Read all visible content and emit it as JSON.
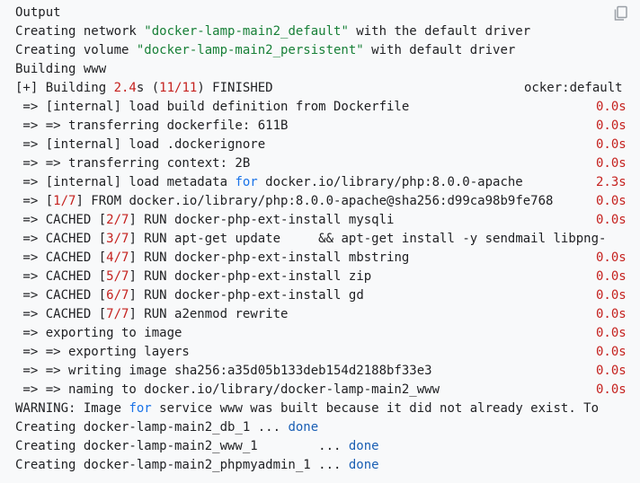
{
  "output_label": "Output",
  "copy_icon": "copy-icon",
  "lines": {
    "l1a": "Creating network ",
    "l1b": "\"docker-lamp-main2_default\"",
    "l1c": " with the default driver",
    "l2a": "Creating volume ",
    "l2b": "\"docker-lamp-main2_persistent\"",
    "l2c": " with default driver",
    "l3": "Building www",
    "l4a": "[+] Building ",
    "l4b": "2.4",
    "l4c": "s (",
    "l4d": "11/11",
    "l4e": ") FINISHED",
    "l4f": "ocker:default",
    "l5": " => [internal] load build definition from Dockerfile",
    "l5t": "0.0s",
    "l6": " => => transferring dockerfile: 611B",
    "l6t": "0.0s",
    "l7": " => [internal] load .dockerignore",
    "l7t": "0.0s",
    "l8": " => => transferring context: 2B",
    "l8t": "0.0s",
    "l9a": " => [internal] load metadata ",
    "l9b": "for",
    "l9c": " docker.io/library/php:8.0.0-apache",
    "l9t": "2.3s",
    "l10a": " => [",
    "l10b": "1/7",
    "l10c": "] FROM docker.io/library/php:8.0.0-apache@sha256:d99ca98b9fe768 ",
    "l10t": "0.0s",
    "l11a": " => CACHED [",
    "l11b": "2/7",
    "l11c": "] RUN docker-php-ext-install mysqli",
    "l11t": "0.0s",
    "l12a": " => CACHED [",
    "l12b": "3/7",
    "l12c": "] RUN apt-get update     && apt-get install -y sendmail libpng-",
    "l13a": " => CACHED [",
    "l13b": "4/7",
    "l13c": "] RUN docker-php-ext-install mbstring",
    "l13t": "0.0s",
    "l14a": " => CACHED [",
    "l14b": "5/7",
    "l14c": "] RUN docker-php-ext-install zip",
    "l14t": "0.0s",
    "l15a": " => CACHED [",
    "l15b": "6/7",
    "l15c": "] RUN docker-php-ext-install gd",
    "l15t": "0.0s",
    "l16a": " => CACHED [",
    "l16b": "7/7",
    "l16c": "] RUN a2enmod rewrite",
    "l16t": "0.0s",
    "l17": " => exporting to image",
    "l17t": "0.0s",
    "l18": " => => exporting layers",
    "l18t": "0.0s",
    "l19": " => => writing image sha256:a35d05b133deb154d2188bf33e3",
    "l19t": "0.0s",
    "l20": " => => naming to docker.io/library/docker-lamp-main2_www",
    "l20t": "0.0s",
    "l21a": "WARNING: Image ",
    "l21b": "for",
    "l21c": " service www was built because it did not already exist. To",
    "l22a": "Creating docker-lamp-main2_db_1 ... ",
    "l22b": "done",
    "l23a": "Creating docker-lamp-main2_www_1        ... ",
    "l23b": "done",
    "l24a": "Creating docker-lamp-main2_phpmyadmin_1 ... ",
    "l24b": "done"
  }
}
